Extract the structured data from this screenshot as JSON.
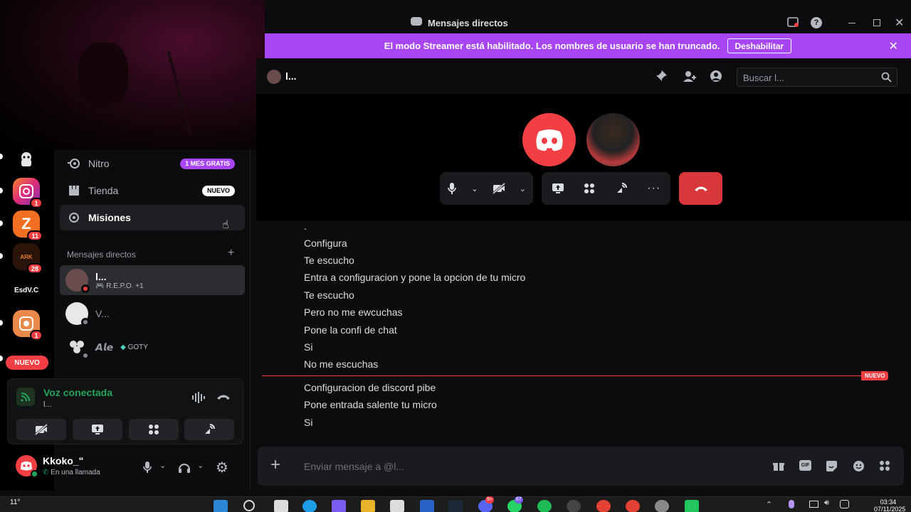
{
  "window": {
    "title": "Mensajes directos"
  },
  "banner": {
    "text": "El modo Streamer está habilitado. Los nombres de usuario se han truncado.",
    "disable_label": "Deshabilitar"
  },
  "header": {
    "channel_name": "l...",
    "search_placeholder": "Buscar l..."
  },
  "rail": {
    "servers": [
      {
        "name": "server-1",
        "badge": ""
      },
      {
        "name": "server-2",
        "badge": "1"
      },
      {
        "name": "server-3",
        "badge": "11"
      },
      {
        "name": "server-4",
        "badge": "28",
        "label": "ARK"
      },
      {
        "name": "server-5",
        "badge": "",
        "label": "EsdV.C"
      },
      {
        "name": "server-6",
        "badge": "1"
      }
    ],
    "nuevo_label": "NUEVO"
  },
  "sidebar": {
    "nitro_label": "Nitro",
    "nitro_tag": "1 MES GRATIS",
    "tienda_label": "Tienda",
    "tienda_tag": "NUEVO",
    "misiones_label": "Misiones",
    "dm_header": "Mensajes directos",
    "dms": [
      {
        "name": "l...",
        "activity": "R.E.P.O. +1"
      },
      {
        "name": "V...",
        "activity": ""
      },
      {
        "name": "𝘼𝙡𝙚",
        "activity": "GOTY"
      }
    ]
  },
  "voice": {
    "status": "Voz conectada",
    "channel": "l..."
  },
  "user": {
    "name": "Kkoko_\"",
    "status": "En una llamada"
  },
  "chat": {
    "messages": [
      ".",
      "Configura",
      "Te escucho",
      "Entra a configuracion y pone la opcion de tu micro",
      "Te escucho",
      "Pero no me ewcuchas",
      "Pone la confi de chat",
      "Si",
      "No me escuchas"
    ],
    "new_label": "NUEVO",
    "new_messages": [
      "Configuracion de discord pibe",
      "Pone entrada salente tu micro",
      "Si"
    ]
  },
  "composer": {
    "placeholder": "Enviar mensaje a @l..."
  },
  "taskbar": {
    "weather": "11°",
    "time": "03:34",
    "date": "07/11/2025",
    "discord_badge": "9+",
    "whatsapp_badge": "67"
  },
  "colors": {
    "banner": "#a846f5",
    "blurple": "#5865f2",
    "discord_red": "#f23f43",
    "green": "#23a55a",
    "hangup": "#da373c",
    "nitro_tag": "#a846f5"
  }
}
